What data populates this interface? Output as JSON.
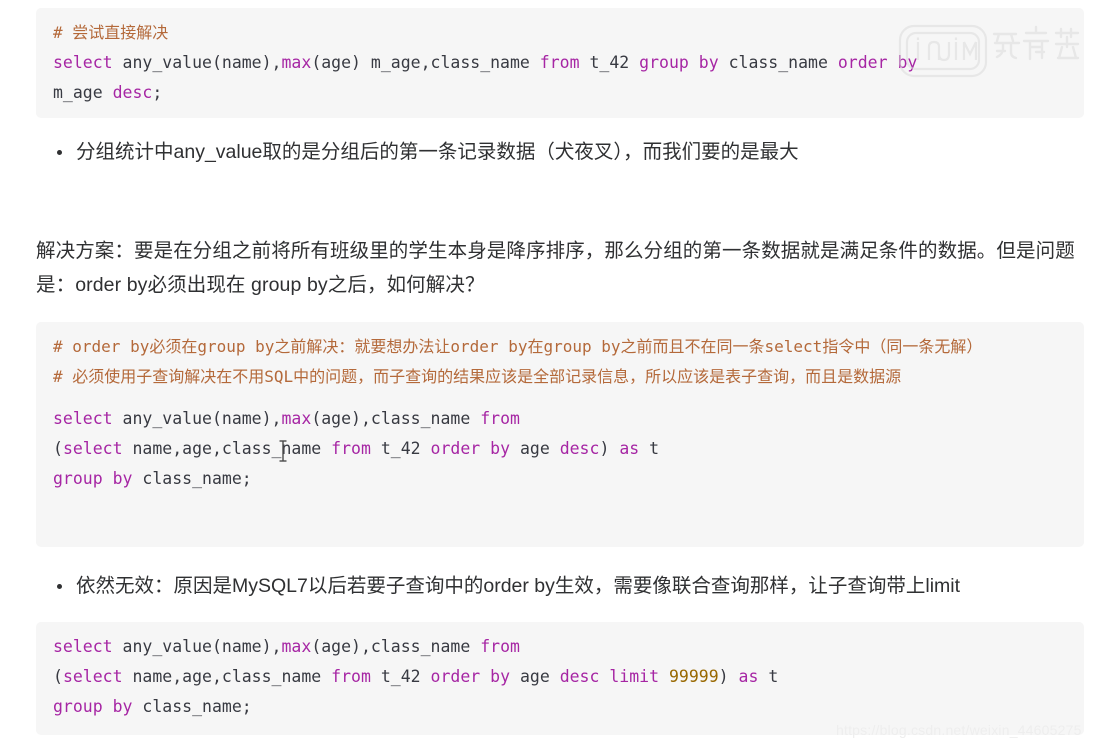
{
  "page": {
    "background_color": "#ffffff",
    "text_color": "#2f3032"
  },
  "code_theme": {
    "block_background": "#f6f6f6",
    "comment_color": "#b4693a",
    "keyword_color": "#a626a4",
    "plain_color": "#383a42",
    "number_color": "#986801"
  },
  "code_block_1": {
    "comment": "# 尝试直接解决",
    "line2": {
      "kw_select": "select",
      "plain_1": " any_value(name),",
      "kw_max": "max",
      "plain_2": "(age) m_age,class_name ",
      "kw_from": "from",
      "plain_3": " t_42 ",
      "kw_group_by": "group by",
      "plain_4": " class_name ",
      "kw_order_by": "order by"
    },
    "line3": {
      "plain_1": "m_age ",
      "kw_desc": "desc",
      "plain_2": ";"
    }
  },
  "bullet_1": "分组统计中any_value取的是分组后的第一条记录数据（犬夜叉），而我们要的是最大",
  "paragraph": "解决方案：要是在分组之前将所有班级里的学生本身是降序排序，那么分组的第一条数据就是满足条件的数据。但是问题是：order by必须出现在 group by之后，如何解决？",
  "code_block_2": {
    "comment_1": "# order by必须在group by之前解决：就要想办法让order by在group by之前而且不在同一条select指令中（同一条无解）",
    "comment_2": "# 必须使用子查询解决在不用SQL中的问题，而子查询的结果应该是全部记录信息，所以应该是表子查询，而且是数据源",
    "line1": {
      "kw_select": "select",
      "plain_1": " any_value(name),",
      "kw_max": "max",
      "plain_2": "(age),class_name ",
      "kw_from": "from"
    },
    "line2": {
      "plain_1": "(",
      "kw_select": "select",
      "plain_2": " name,age,class_name ",
      "kw_from": "from",
      "plain_3": " t_42 ",
      "kw_order_by": "order by",
      "plain_4": " age ",
      "kw_desc": "desc",
      "plain_5": ") ",
      "kw_as": "as",
      "plain_6": " t"
    },
    "line3": {
      "kw_group_by": "group by",
      "plain_1": " class_name;"
    }
  },
  "bullet_2": "依然无效：原因是MySQL7以后若要子查询中的order by生效，需要像联合查询那样，让子查询带上limit",
  "code_block_3": {
    "line1": {
      "kw_select": "select",
      "plain_1": " any_value(name),",
      "kw_max": "max",
      "plain_2": "(age),class_name ",
      "kw_from": "from"
    },
    "line2": {
      "plain_1": "(",
      "kw_select": "select",
      "plain_2": " name,age,class_name ",
      "kw_from": "from",
      "plain_3": " t_42 ",
      "kw_order_by": "order by",
      "plain_4": " age ",
      "kw_desc": "desc",
      "kw_limit": " limit",
      "num_limit": " 99999",
      "plain_5": ") ",
      "kw_as": "as",
      "plain_6": " t"
    },
    "line3": {
      "kw_group_by": "group by",
      "plain_1": " class_name;"
    }
  },
  "watermark": {
    "logo_text": "iQIYI",
    "logo_cn_text": "爱奇艺",
    "footer_url": "https://blog.csdn.net/weixin_44605275"
  }
}
